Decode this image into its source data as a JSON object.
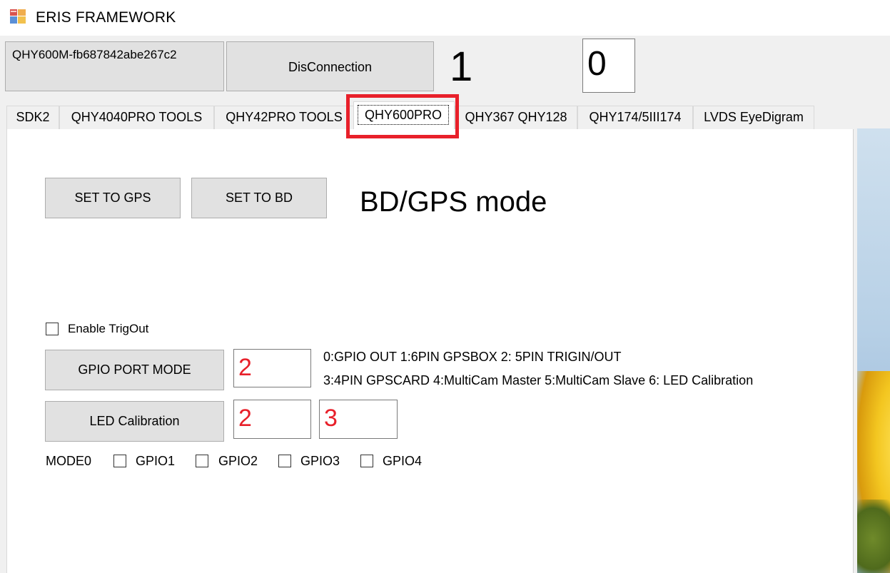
{
  "window": {
    "title": "ERIS FRAMEWORK",
    "icon": "windows-form-icon"
  },
  "header": {
    "device_label": "QHY600M-fb687842abe267c2",
    "disconnect_label": "DisConnection",
    "count_value": "1",
    "value_box": "0"
  },
  "tabs": [
    {
      "label": "SDK2"
    },
    {
      "label": "QHY4040PRO TOOLS"
    },
    {
      "label": "QHY42PRO TOOLS"
    },
    {
      "label": "QHY600PRO",
      "active": true
    },
    {
      "label": "QHY367 QHY128"
    },
    {
      "label": "QHY174/5III174"
    },
    {
      "label": "LVDS EyeDigram"
    }
  ],
  "gps": {
    "set_gps_label": "SET TO GPS",
    "set_bd_label": "SET TO BD",
    "mode_title": "BD/GPS mode"
  },
  "trigout": {
    "label": "Enable TrigOut",
    "checked": false
  },
  "gpio": {
    "mode_button_label": "GPIO PORT MODE",
    "mode_value": "2",
    "help_line1": "0:GPIO OUT  1:6PIN GPSBOX  2: 5PIN TRIGIN/OUT",
    "help_line2": "3:4PIN GPSCARD 4:MultiCam Master 5:MultiCam Slave 6: LED Calibration"
  },
  "led": {
    "button_label": "LED Calibration",
    "value1": "2",
    "value2": "3"
  },
  "mode0": {
    "label": "MODE0",
    "options": [
      {
        "label": "GPIO1",
        "checked": false
      },
      {
        "label": "GPIO2",
        "checked": false
      },
      {
        "label": "GPIO3",
        "checked": false
      },
      {
        "label": "GPIO4",
        "checked": false
      }
    ]
  },
  "colors": {
    "highlight": "#e8202a",
    "input_value": "#e8202a",
    "button_bg": "#e1e1e1",
    "window_bg": "#f0f0f0"
  }
}
